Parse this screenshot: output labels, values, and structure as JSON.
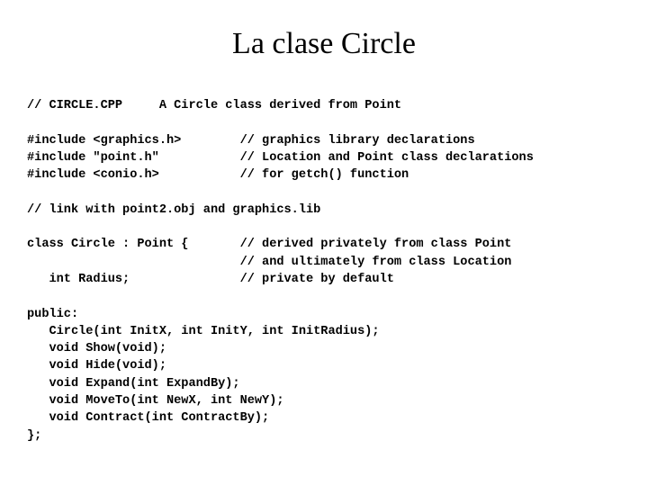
{
  "slide": {
    "title": "La clase Circle",
    "background_color": "#ffffff",
    "text_color": "#000000"
  },
  "code": {
    "language": "cpp",
    "comment_column": 30,
    "lines": [
      "// CIRCLE.CPP     A Circle class derived from Point",
      "",
      "#include <graphics.h>        // graphics library declarations",
      "#include \"point.h\"           // Location and Point class declarations",
      "#include <conio.h>           // for getch() function",
      "",
      "// link with point2.obj and graphics.lib",
      "",
      "class Circle : Point {       // derived privately from class Point",
      "                             // and ultimately from class Location",
      "   int Radius;               // private by default",
      "",
      "public:",
      "   Circle(int InitX, int InitY, int InitRadius);",
      "   void Show(void);",
      "   void Hide(void);",
      "   void Expand(int ExpandBy);",
      "   void MoveTo(int NewX, int NewY);",
      "   void Contract(int ContractBy);",
      "};"
    ]
  }
}
